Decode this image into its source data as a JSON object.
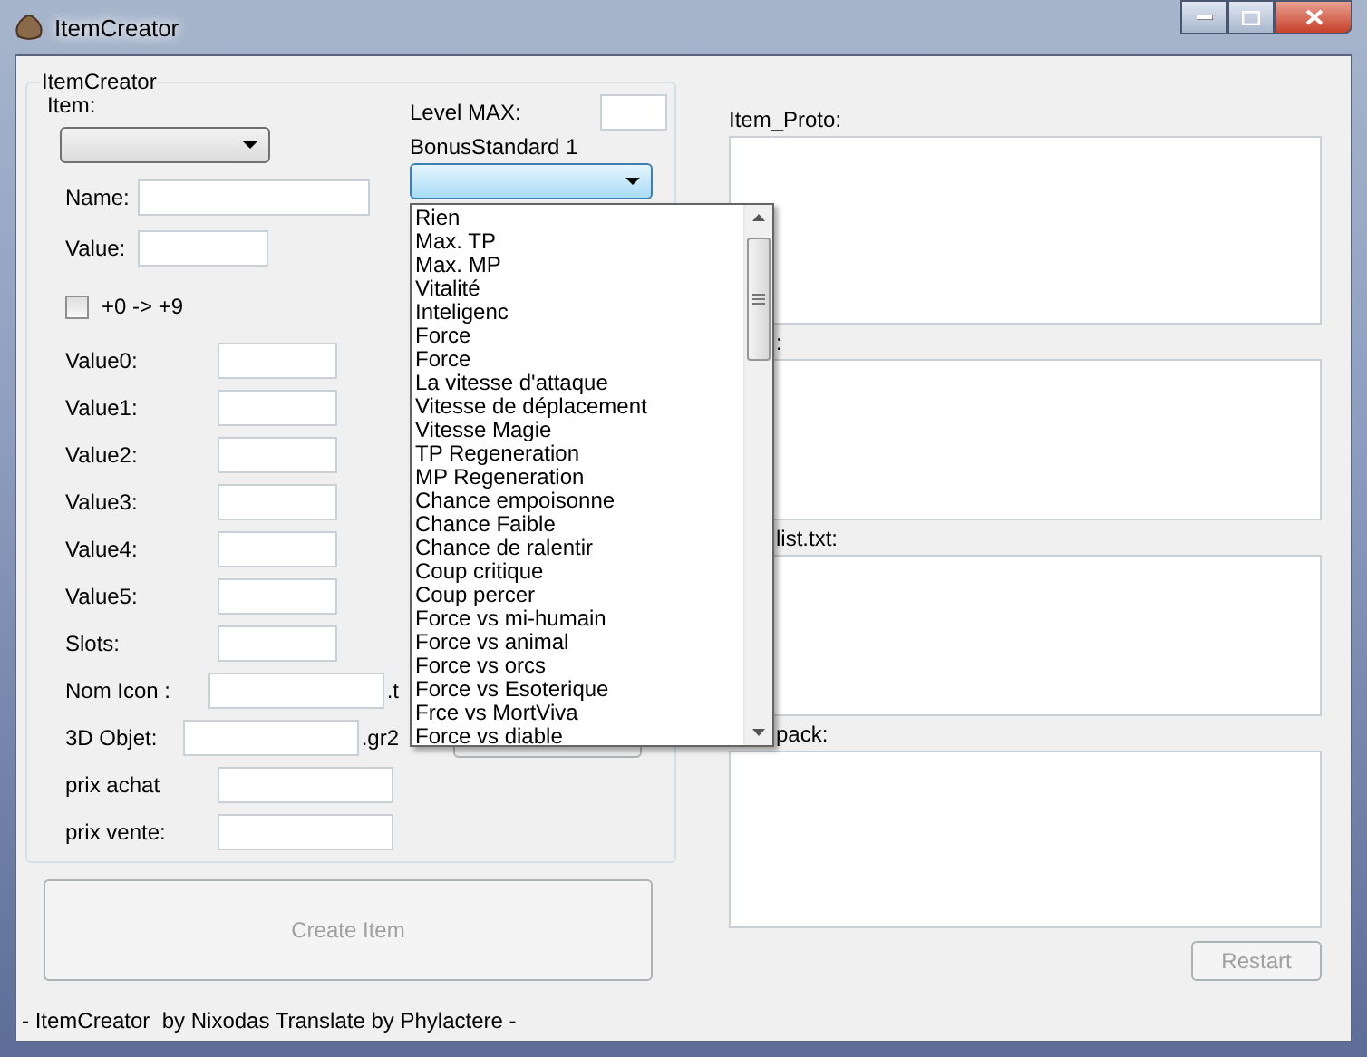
{
  "window": {
    "title": "ItemCreator"
  },
  "groupbox": {
    "title": "ItemCreator",
    "item_label": "Item:",
    "name_label": "Name:",
    "value_label": "Value:",
    "checkbox": {
      "label": "+0 -> +9",
      "checked": false
    },
    "fields": [
      {
        "label": "Value0:",
        "kind": "short"
      },
      {
        "label": "Value1:",
        "kind": "short"
      },
      {
        "label": "Value2:",
        "kind": "short"
      },
      {
        "label": "Value3:",
        "kind": "short"
      },
      {
        "label": "Value4:",
        "kind": "short"
      },
      {
        "label": "Value5:",
        "kind": "short"
      },
      {
        "label": "Slots:",
        "kind": "short"
      },
      {
        "label": "Nom Icon :",
        "kind": "wide",
        "suffix": ".t"
      },
      {
        "label": "3D Objet:",
        "kind": "wide",
        "suffix": ".gr2"
      },
      {
        "label": "prix achat",
        "kind": "wide"
      },
      {
        "label": "prix vente:",
        "kind": "wide"
      }
    ],
    "level_max_label": "Level MAX:",
    "bonus_label": "BonusStandard 1",
    "bonus_options": [
      "Rien",
      "Max. TP",
      "Max. MP",
      "Vitalité",
      "Inteligenc",
      "Force",
      "Force",
      "La vitesse d'attaque",
      "Vitesse de déplacement",
      "Vitesse Magie",
      "TP Regeneration",
      "MP Regeneration",
      "Chance empoisonne",
      "Chance Faible",
      "Chance de ralentir",
      "Coup critique",
      "Coup percer",
      "Force vs mi-humain",
      "Force vs animal",
      "Force vs orcs",
      "Force vs Esoterique",
      "Frce vs MortViva",
      "Force vs diable"
    ]
  },
  "create_button": {
    "label": "Create Item",
    "disabled": true
  },
  "text_areas": [
    {
      "label": "Item_Proto:",
      "covered": false
    },
    {
      "label": ":",
      "covered": true
    },
    {
      "label": "list.txt:",
      "covered": true
    },
    {
      "label": "pack:",
      "covered": true
    }
  ],
  "restart_button": {
    "label": "Restart",
    "disabled": true
  },
  "status_bar": "- ItemCreator  by Nixodas Translate by Phylactere -"
}
